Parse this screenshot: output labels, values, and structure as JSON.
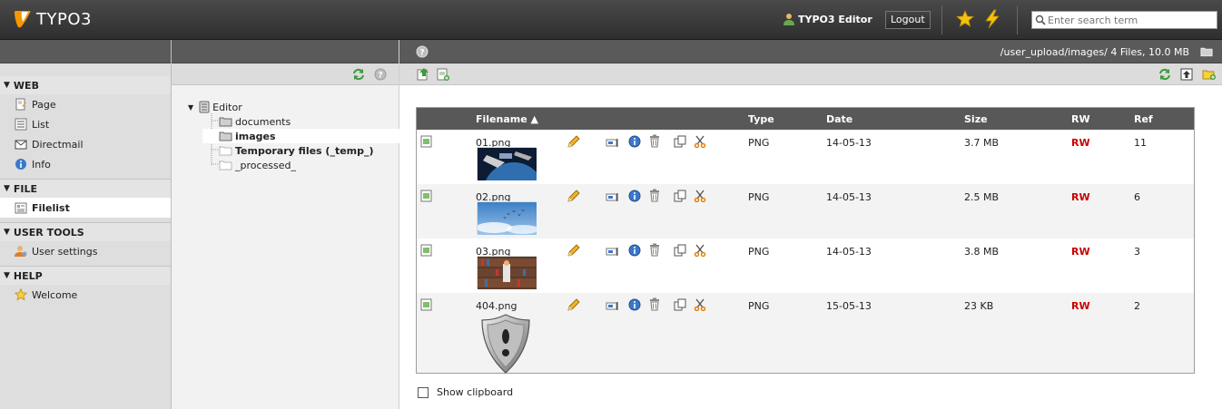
{
  "topbar": {
    "logo_text": "TYPO3",
    "user_name": "TYPO3 Editor",
    "logout_label": "Logout",
    "search_placeholder": "Enter search term"
  },
  "module_menu": [
    {
      "title": "WEB",
      "items": [
        {
          "label": "Page",
          "icon": "page-icon"
        },
        {
          "label": "List",
          "icon": "list-icon"
        },
        {
          "label": "Directmail",
          "icon": "mail-icon"
        },
        {
          "label": "Info",
          "icon": "info-icon"
        }
      ]
    },
    {
      "title": "FILE",
      "items": [
        {
          "label": "Filelist",
          "icon": "filelist-icon",
          "active": true
        }
      ]
    },
    {
      "title": "USER TOOLS",
      "items": [
        {
          "label": "User settings",
          "icon": "user-settings-icon"
        }
      ]
    },
    {
      "title": "HELP",
      "items": [
        {
          "label": "Welcome",
          "icon": "star-icon"
        }
      ]
    }
  ],
  "tree": {
    "root": "Editor",
    "children": [
      "documents",
      "images",
      "Temporary files (_temp_)",
      "_processed_"
    ],
    "selected": "images"
  },
  "main": {
    "path": "/user_upload/images/ 4 Files, 10.0 MB"
  },
  "table": {
    "headers": {
      "filename": "Filename",
      "type": "Type",
      "date": "Date",
      "size": "Size",
      "rw": "RW",
      "ref": "Ref"
    },
    "sort_arrow": "▲",
    "rows": [
      {
        "filename": "01.png",
        "type": "PNG",
        "date": "14-05-13",
        "size": "3.7 MB",
        "rw": "RW",
        "ref": "11",
        "thumb": "earth-orbit"
      },
      {
        "filename": "02.png",
        "type": "PNG",
        "date": "14-05-13",
        "size": "2.5 MB",
        "rw": "RW",
        "ref": "6",
        "thumb": "sky-birds"
      },
      {
        "filename": "03.png",
        "type": "PNG",
        "date": "14-05-13",
        "size": "3.8 MB",
        "rw": "RW",
        "ref": "3",
        "thumb": "library"
      },
      {
        "filename": "404.png",
        "type": "PNG",
        "date": "15-05-13",
        "size": "23 KB",
        "rw": "RW",
        "ref": "2",
        "thumb": "shield-404"
      }
    ]
  },
  "clipboard_label": "Show clipboard",
  "colors": {
    "accent": "#f49700",
    "rw": "#cc0000",
    "header": "#585858"
  }
}
